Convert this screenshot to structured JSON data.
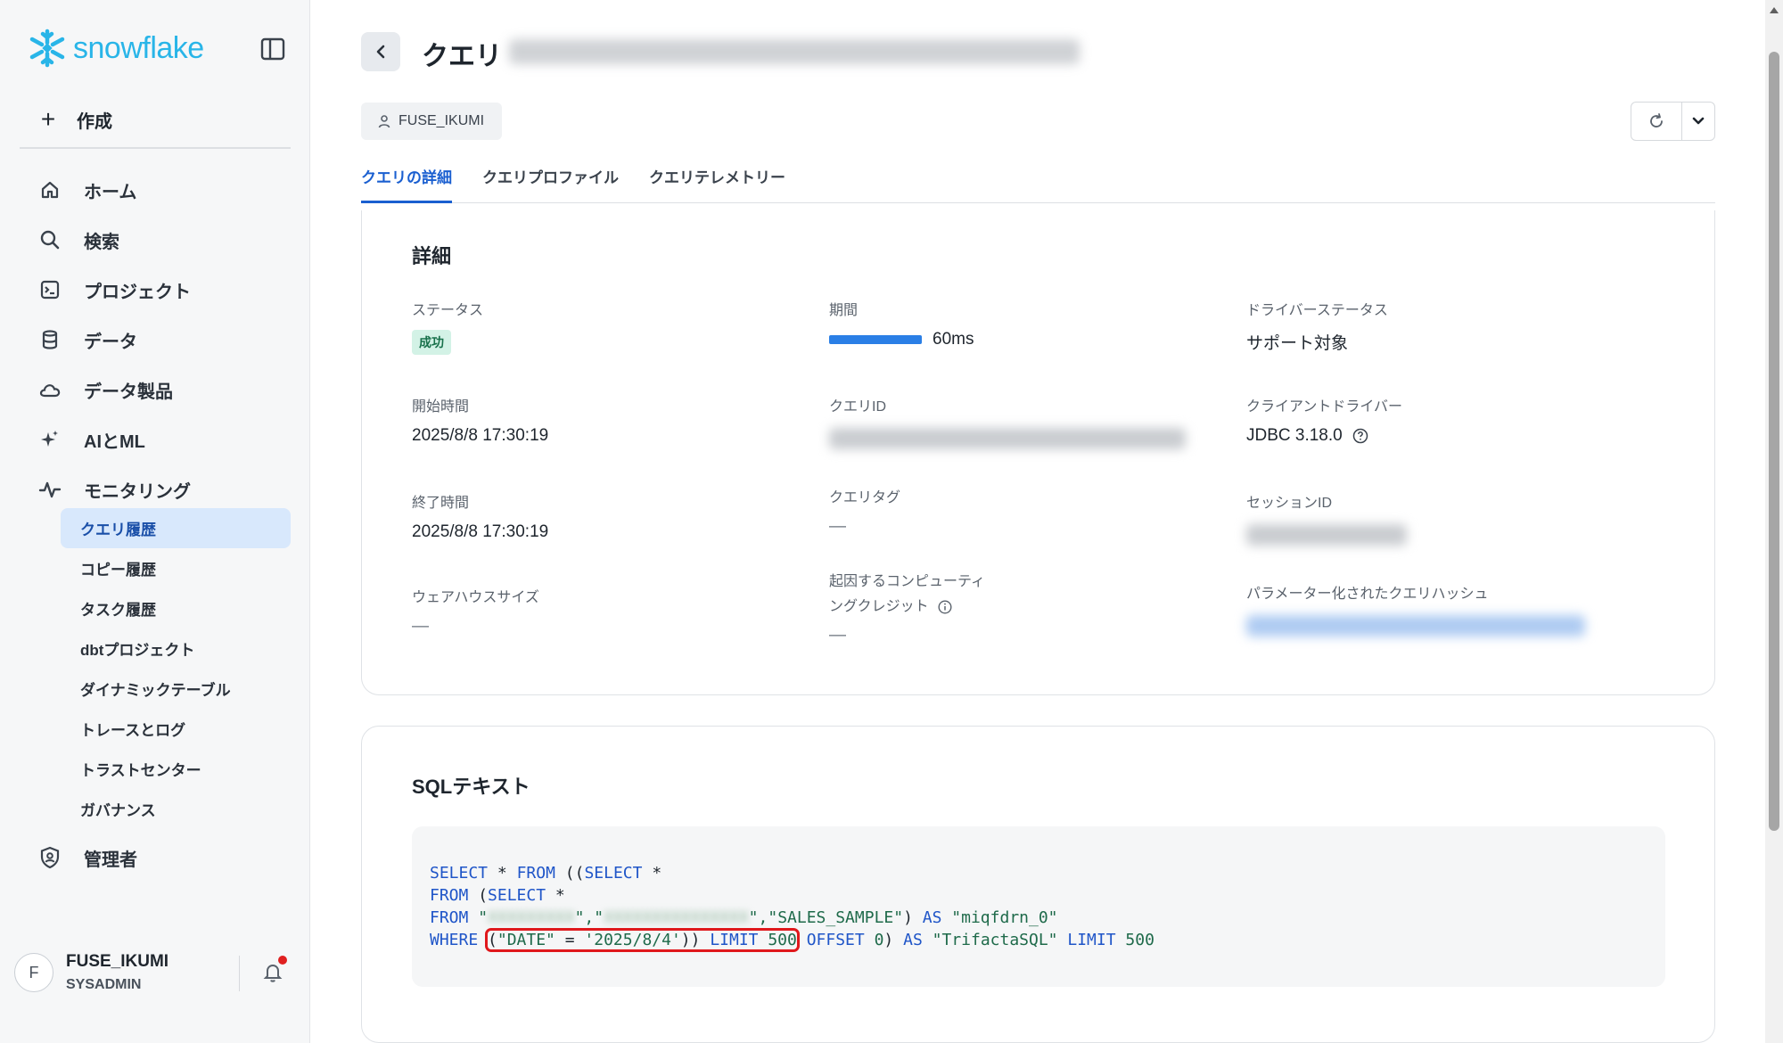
{
  "brand": {
    "name": "snowflake",
    "color": "#29b5e8"
  },
  "sidebar": {
    "create_label": "作成",
    "items": [
      {
        "label": "ホーム",
        "icon": "home-icon"
      },
      {
        "label": "検索",
        "icon": "search-icon"
      },
      {
        "label": "プロジェクト",
        "icon": "terminal-icon"
      },
      {
        "label": "データ",
        "icon": "database-icon"
      },
      {
        "label": "データ製品",
        "icon": "cloud-icon"
      },
      {
        "label": "AIとML",
        "icon": "sparkle-icon"
      },
      {
        "label": "モニタリング",
        "icon": "activity-icon"
      }
    ],
    "monitoring_sub": [
      {
        "label": "クエリ履歴",
        "active": true
      },
      {
        "label": "コピー履歴"
      },
      {
        "label": "タスク履歴"
      },
      {
        "label": "dbtプロジェクト"
      },
      {
        "label": "ダイナミックテーブル"
      },
      {
        "label": "トレースとログ"
      },
      {
        "label": "トラストセンター"
      },
      {
        "label": "ガバナンス"
      }
    ],
    "admin_label": "管理者",
    "user": {
      "initial": "F",
      "name": "FUSE_IKUMI",
      "role": "SYSADMIN"
    }
  },
  "header": {
    "title": "クエリ",
    "user_chip": "FUSE_IKUMI",
    "tabs": [
      "クエリの詳細",
      "クエリプロファイル",
      "クエリテレメトリー"
    ]
  },
  "details": {
    "title": "詳細",
    "status_label": "ステータス",
    "status_value": "成功",
    "duration_label": "期間",
    "duration_value": "60ms",
    "duration_fill": 1.0,
    "driver_status_label": "ドライバーステータス",
    "driver_status_value": "サポート対象",
    "start_label": "開始時間",
    "start_value": "2025/8/8 17:30:19",
    "query_id_label": "クエリID",
    "client_driver_label": "クライアントドライバー",
    "client_driver_value": "JDBC 3.18.0",
    "end_label": "終了時間",
    "end_value": "2025/8/8 17:30:19",
    "query_tag_label": "クエリタグ",
    "query_tag_value": "—",
    "session_id_label": "セッションID",
    "warehouse_label": "ウェアハウスサイズ",
    "warehouse_value": "—",
    "credits_label_1": "起因するコンピューティ",
    "credits_label_2": "ングクレジット",
    "credits_value": "—",
    "hash_label": "パラメーター化されたクエリハッシュ"
  },
  "sql": {
    "title": "SQLテキスト",
    "kw_select": "SELECT",
    "kw_from": "FROM",
    "kw_where": "WHERE",
    "kw_as": "AS",
    "kw_limit": "LIMIT",
    "kw_offset": "OFFSET",
    "star": "*",
    "table": "\"SALES_SAMPLE\"",
    "alias1": "\"miqfdrn_0\"",
    "cond_col": "\"DATE\"",
    "cond_val": "'2025/8/4'",
    "limit1": "500",
    "offset": "0",
    "alias2": "\"TrifactaSQL\"",
    "limit2": "500"
  }
}
